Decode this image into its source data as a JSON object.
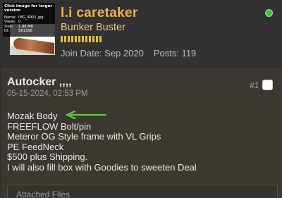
{
  "thumbnail": {
    "caption_title": "Click image for larger version",
    "rows": [
      {
        "key": "Name:",
        "value": "IMG_4901.jpg"
      },
      {
        "key": "Views:",
        "value": "0"
      },
      {
        "key": "Size:",
        "value": "1.86 MB"
      },
      {
        "key": "ID:",
        "value": "561356"
      }
    ]
  },
  "user": {
    "name": "l.i caretaker",
    "title": "Bunker Buster",
    "join_date": "Join Date: Sep 2020",
    "posts": "Posts: 119",
    "reputation_pips": 12,
    "status": "online"
  },
  "post": {
    "title": "Autocker ,,,,",
    "date": "05-15-2024, 02:53 PM",
    "number": "#1",
    "body_lines": [
      "Mozak Body",
      "FREEFLOW Bolt/pin",
      "Meteror OG Style frame with VL Grips",
      "PE FeedNeck",
      "$500 plus Shipping.",
      "I will also fill box with Goodies to sweeten Deal"
    ],
    "attached_label": "Attached Files"
  },
  "colors": {
    "username": "#f0b23e",
    "reputation": "#e8c21a",
    "online": "#37d12a",
    "arrow": "#58d13a"
  }
}
